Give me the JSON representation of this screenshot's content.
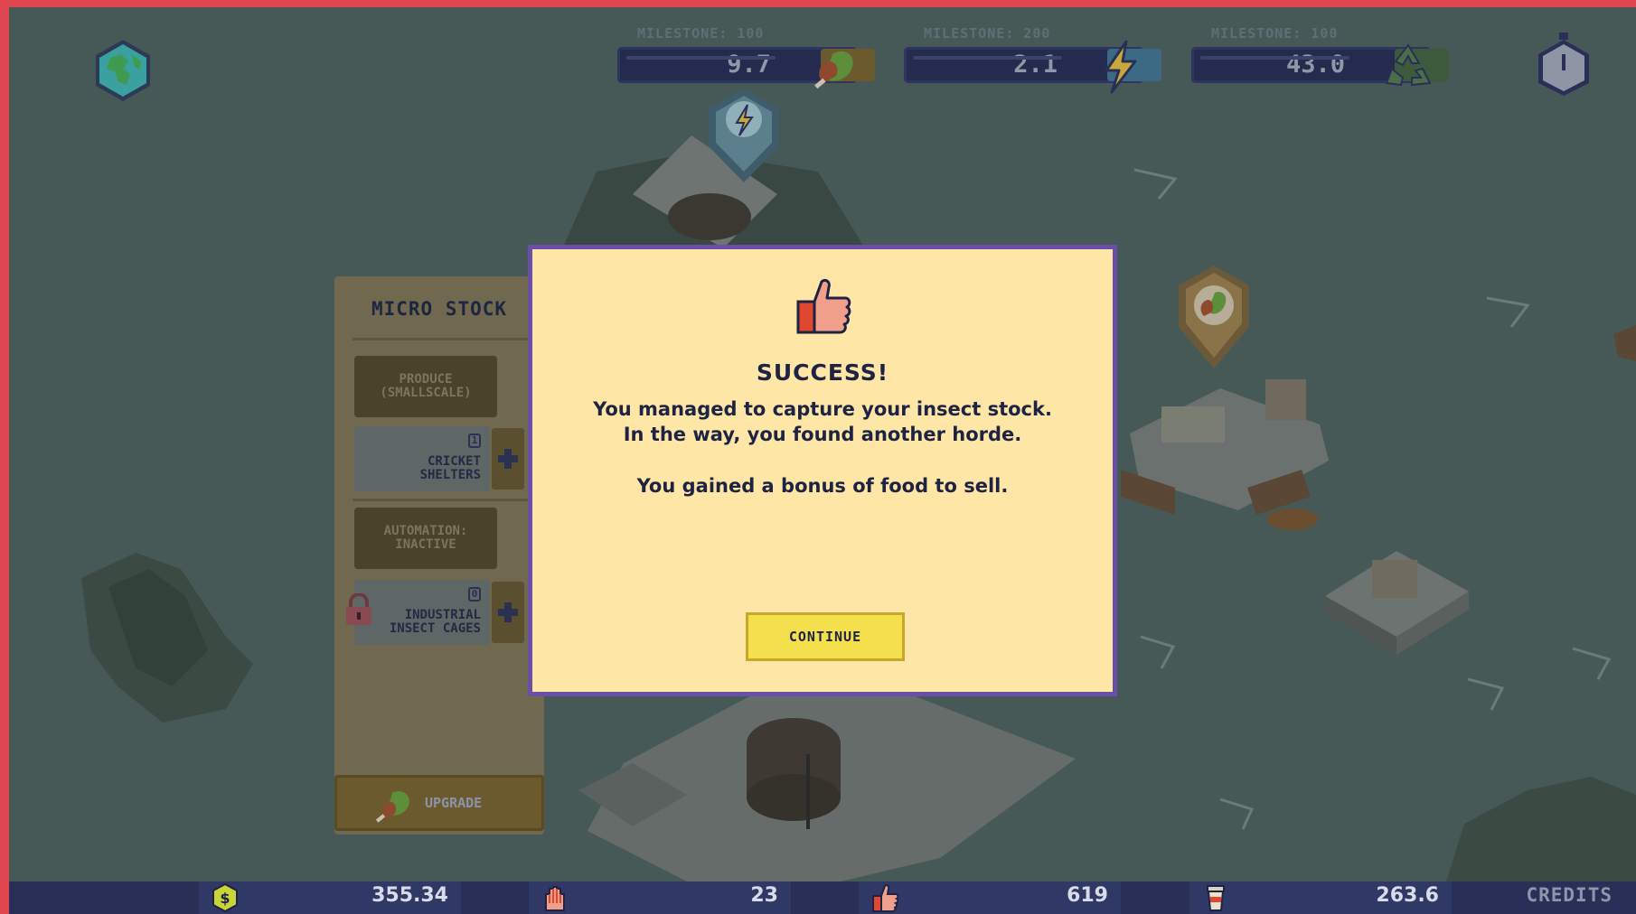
{
  "hud": {
    "milestones": [
      {
        "label": "MILESTONE: 100",
        "value": "9.7",
        "icon": "food-drumstick-leaf-icon"
      },
      {
        "label": "MILESTONE: 200",
        "value": "2.1",
        "icon": "lightning-energy-icon"
      },
      {
        "label": "MILESTONE: 100",
        "value": "43.0",
        "icon": "recycle-icon"
      }
    ],
    "earth_icon": "earth-icon",
    "timer_icon": "stopwatch-icon"
  },
  "map_markers": [
    {
      "icon": "lightning-energy-icon",
      "color": "#6fa6c4"
    },
    {
      "icon": "food-drumstick-leaf-icon",
      "color": "#d9a54a"
    }
  ],
  "side_panel": {
    "title": "MICRO STOCK",
    "produce_button": "PRODUCE (SMALLSCALE)",
    "cricket": {
      "label_line1": "CRICKET",
      "label_line2": "SHELTERS",
      "count": "1"
    },
    "automation_button_line1": "AUTOMATION:",
    "automation_button_line2": "INACTIVE",
    "industrial": {
      "label_line1": "INDUSTRIAL",
      "label_line2": "INSECT CAGES",
      "count": "0",
      "locked": true
    },
    "upgrade_label": "UPGRADE"
  },
  "modal": {
    "icon": "thumbs-up-icon",
    "title": "SUCCESS!",
    "line1": "You managed to capture your insect stock.",
    "line2": "In the way, you found another horde.",
    "line3": "You gained a bonus of food to sell.",
    "continue_label": "CONTINUE"
  },
  "bottom_bar": {
    "money": {
      "icon": "coin-icon",
      "value": "355.34"
    },
    "population": {
      "icon": "people-hands-icon",
      "value": "23"
    },
    "approval": {
      "icon": "thumbs-up-icon",
      "value": "619"
    },
    "waste": {
      "icon": "trash-bin-icon",
      "value": "263.6"
    },
    "credits_label": "CREDITS"
  },
  "colors": {
    "frame": "#e0464f",
    "modal_bg": "#fde6a6",
    "modal_border": "#6a4fa8",
    "continue_bg": "#f4df4c",
    "bar_bg": "#2a2f57",
    "text_dark": "#1f2343"
  }
}
